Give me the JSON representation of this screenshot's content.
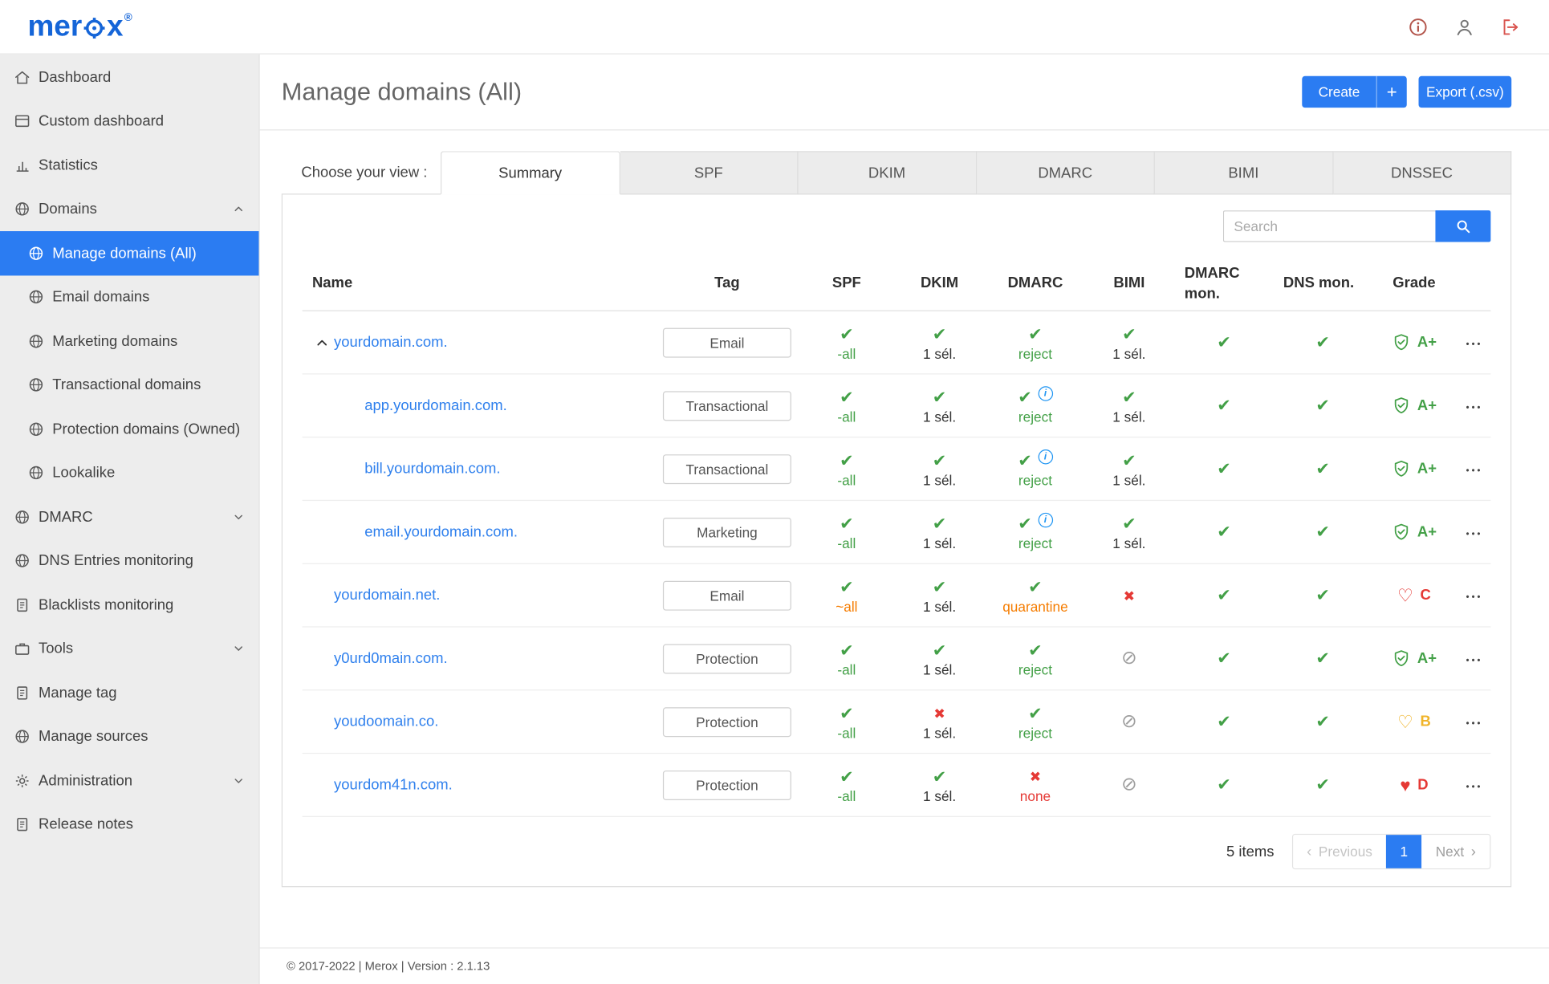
{
  "palette": {
    "primary": "#2b7cf2",
    "link": "#2f80ed",
    "green": "#43a047",
    "red": "#e53935",
    "orange": "#f57c00",
    "yellow": "#f0b429",
    "ban": "#9e9e9e",
    "logo-blue": "#1565d8",
    "info-red": "#b3554b",
    "icon-gray": "#757575",
    "logout-red": "#d9544f",
    "sidebar-bg": "#ededed"
  },
  "brand": {
    "logo_pre": "mer",
    "logo_post": "x",
    "reg": "®"
  },
  "sidebar": {
    "items": [
      {
        "label": "Dashboard",
        "icon": "home",
        "level": 0
      },
      {
        "label": "Custom dashboard",
        "icon": "window",
        "level": 0
      },
      {
        "label": "Statistics",
        "icon": "chart",
        "level": 0
      },
      {
        "label": "Domains",
        "icon": "globe",
        "level": 0,
        "chevron": "up"
      },
      {
        "label": "Manage domains (All)",
        "icon": "globe",
        "level": 1,
        "active": true
      },
      {
        "label": "Email domains",
        "icon": "globe",
        "level": 1
      },
      {
        "label": "Marketing domains",
        "icon": "globe",
        "level": 1
      },
      {
        "label": "Transactional domains",
        "icon": "globe",
        "level": 1
      },
      {
        "label": "Protection domains (Owned)",
        "icon": "globe",
        "level": 1
      },
      {
        "label": "Lookalike",
        "icon": "globe",
        "level": 1
      },
      {
        "label": "DMARC",
        "icon": "globe",
        "level": 0,
        "chevron": "down"
      },
      {
        "label": "DNS Entries monitoring",
        "icon": "globe",
        "level": 0
      },
      {
        "label": "Blacklists monitoring",
        "icon": "doc",
        "level": 0
      },
      {
        "label": "Tools",
        "icon": "case",
        "level": 0,
        "chevron": "down"
      },
      {
        "label": "Manage tag",
        "icon": "doc",
        "level": 0
      },
      {
        "label": "Manage sources",
        "icon": "globe",
        "level": 0
      },
      {
        "label": "Administration",
        "icon": "gear",
        "level": 0,
        "chevron": "down"
      },
      {
        "label": "Release notes",
        "icon": "doc",
        "level": 0
      }
    ]
  },
  "header": {
    "title": "Manage domains (All)",
    "create_label": "Create",
    "create_plus": "+",
    "export_label": "Export (.csv)"
  },
  "view_tabs": {
    "label": "Choose your view :",
    "tabs": [
      {
        "label": "Summary",
        "active": true
      },
      {
        "label": "SPF"
      },
      {
        "label": "DKIM"
      },
      {
        "label": "DMARC"
      },
      {
        "label": "BIMI"
      },
      {
        "label": "DNSSEC"
      }
    ]
  },
  "search": {
    "placeholder": "Search"
  },
  "table": {
    "headers": [
      "Name",
      "Tag",
      "SPF",
      "DKIM",
      "DMARC",
      "BIMI",
      "DMARC mon.",
      "DNS mon.",
      "Grade"
    ],
    "rows": [
      {
        "name": "yourdomain.com.",
        "level": 0,
        "expander": true,
        "tag": "Email",
        "spf": {
          "icon": "check",
          "text": "-all",
          "tone": "ok"
        },
        "dkim": {
          "icon": "check",
          "text": "1 sél.",
          "tone": "neutral"
        },
        "dmarc": {
          "icon": "check",
          "info": false,
          "text": "reject",
          "tone": "ok"
        },
        "bimi": {
          "icon": "check",
          "text": "1 sél.",
          "tone": "neutral"
        },
        "dmarc_mon": {
          "icon": "check"
        },
        "dns_mon": {
          "icon": "check"
        },
        "grade": {
          "icon": "shield",
          "letter": "A+",
          "tone": "ok"
        }
      },
      {
        "name": "app.yourdomain.com.",
        "level": 1,
        "expander": false,
        "tag": "Transactional",
        "spf": {
          "icon": "check",
          "text": "-all",
          "tone": "ok"
        },
        "dkim": {
          "icon": "check",
          "text": "1 sél.",
          "tone": "neutral"
        },
        "dmarc": {
          "icon": "check",
          "info": true,
          "text": "reject",
          "tone": "ok"
        },
        "bimi": {
          "icon": "check",
          "text": "1 sél.",
          "tone": "neutral"
        },
        "dmarc_mon": {
          "icon": "check"
        },
        "dns_mon": {
          "icon": "check"
        },
        "grade": {
          "icon": "shield",
          "letter": "A+",
          "tone": "ok"
        }
      },
      {
        "name": "bill.yourdomain.com.",
        "level": 1,
        "expander": false,
        "tag": "Transactional",
        "spf": {
          "icon": "check",
          "text": "-all",
          "tone": "ok"
        },
        "dkim": {
          "icon": "check",
          "text": "1 sél.",
          "tone": "neutral"
        },
        "dmarc": {
          "icon": "check",
          "info": true,
          "text": "reject",
          "tone": "ok"
        },
        "bimi": {
          "icon": "check",
          "text": "1 sél.",
          "tone": "neutral"
        },
        "dmarc_mon": {
          "icon": "check"
        },
        "dns_mon": {
          "icon": "check"
        },
        "grade": {
          "icon": "shield",
          "letter": "A+",
          "tone": "ok"
        }
      },
      {
        "name": "email.yourdomain.com.",
        "level": 1,
        "expander": false,
        "tag": "Marketing",
        "spf": {
          "icon": "check",
          "text": "-all",
          "tone": "ok"
        },
        "dkim": {
          "icon": "check",
          "text": "1 sél.",
          "tone": "neutral"
        },
        "dmarc": {
          "icon": "check",
          "info": true,
          "text": "reject",
          "tone": "ok"
        },
        "bimi": {
          "icon": "check",
          "text": "1 sél.",
          "tone": "neutral"
        },
        "dmarc_mon": {
          "icon": "check"
        },
        "dns_mon": {
          "icon": "check"
        },
        "grade": {
          "icon": "shield",
          "letter": "A+",
          "tone": "ok"
        }
      },
      {
        "name": "yourdomain.net.",
        "level": 0,
        "expander": false,
        "tag": "Email",
        "spf": {
          "icon": "check",
          "text": "~all",
          "tone": "warn"
        },
        "dkim": {
          "icon": "check",
          "text": "1 sél.",
          "tone": "neutral"
        },
        "dmarc": {
          "icon": "check",
          "info": false,
          "text": "quarantine",
          "tone": "warn"
        },
        "bimi": {
          "icon": "cross"
        },
        "dmarc_mon": {
          "icon": "check"
        },
        "dns_mon": {
          "icon": "check"
        },
        "grade": {
          "icon": "heart-o",
          "letter": "C",
          "tone": "fail"
        }
      },
      {
        "name": "y0urd0main.com.",
        "level": 0,
        "expander": false,
        "tag": "Protection",
        "spf": {
          "icon": "check",
          "text": "-all",
          "tone": "ok"
        },
        "dkim": {
          "icon": "check",
          "text": "1 sél.",
          "tone": "neutral"
        },
        "dmarc": {
          "icon": "check",
          "info": false,
          "text": "reject",
          "tone": "ok"
        },
        "bimi": {
          "icon": "ban"
        },
        "dmarc_mon": {
          "icon": "check"
        },
        "dns_mon": {
          "icon": "check"
        },
        "grade": {
          "icon": "shield",
          "letter": "A+",
          "tone": "ok"
        }
      },
      {
        "name": "youdoomain.co.",
        "level": 0,
        "expander": false,
        "tag": "Protection",
        "spf": {
          "icon": "check",
          "text": "-all",
          "tone": "ok"
        },
        "dkim": {
          "icon": "cross",
          "text": "1 sél.",
          "tone": "neutral"
        },
        "dmarc": {
          "icon": "check",
          "info": false,
          "text": "reject",
          "tone": "ok"
        },
        "bimi": {
          "icon": "ban"
        },
        "dmarc_mon": {
          "icon": "check"
        },
        "dns_mon": {
          "icon": "check"
        },
        "grade": {
          "icon": "heart-o",
          "letter": "B",
          "tone": "yellow"
        }
      },
      {
        "name": "yourdom41n.com.",
        "level": 0,
        "expander": false,
        "tag": "Protection",
        "spf": {
          "icon": "check",
          "text": "-all",
          "tone": "ok"
        },
        "dkim": {
          "icon": "check",
          "text": "1 sél.",
          "tone": "neutral"
        },
        "dmarc": {
          "icon": "cross",
          "info": false,
          "text": "none",
          "tone": "fail"
        },
        "bimi": {
          "icon": "ban"
        },
        "dmarc_mon": {
          "icon": "check"
        },
        "dns_mon": {
          "icon": "check"
        },
        "grade": {
          "icon": "heart",
          "letter": "D",
          "tone": "fail"
        }
      }
    ]
  },
  "pagination": {
    "count_text": "5 items",
    "prev_label": "Previous",
    "page": "1",
    "next_label": "Next"
  },
  "footer": {
    "text": "© 2017-2022 | Merox | Version : 2.1.13"
  }
}
